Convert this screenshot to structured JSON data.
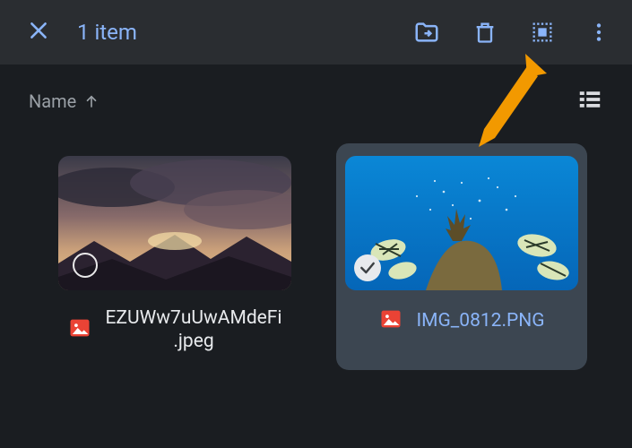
{
  "appbar": {
    "selection_title": "1 item"
  },
  "sort": {
    "label": "Name",
    "direction": "asc"
  },
  "files": [
    {
      "name": "EZUWw7uUwAMdeFi.jpeg",
      "selected": false,
      "thumb": "sunset"
    },
    {
      "name": "IMG_0812.PNG",
      "selected": true,
      "thumb": "ocean"
    }
  ],
  "colors": {
    "accent": "#8ab4f8",
    "icon_red": "#ea4335",
    "annotation": "#f29900"
  }
}
